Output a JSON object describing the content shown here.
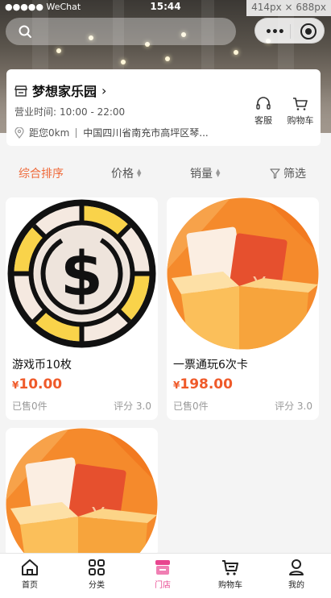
{
  "status_bar": {
    "carrier": "●●●●● WeChat",
    "time": "15:44",
    "dims": "414px × 688px"
  },
  "capsule": {
    "more_glyph": "•••"
  },
  "store": {
    "name": "梦想家乐园",
    "hours_label": "营业时间:",
    "hours_value": "10:00 - 22:00",
    "distance": "距您0km",
    "address": "中国四川省南充市高坪区琴...",
    "service_label": "客服",
    "cart_label": "购物车"
  },
  "sort": {
    "items": [
      {
        "label": "综合排序",
        "active": true
      },
      {
        "label": "价格",
        "active": false
      },
      {
        "label": "销量",
        "active": false
      },
      {
        "label": "筛选",
        "active": false
      }
    ]
  },
  "products": [
    {
      "name": "游戏币10枚",
      "currency": "¥",
      "price": "10.00",
      "sold": "已售0件",
      "rating": "评分 3.0",
      "image": "coin-icon"
    },
    {
      "name": "一票通玩6次卡",
      "currency": "¥",
      "price": "198.00",
      "sold": "已售0件",
      "rating": "评分 3.0",
      "image": "red-envelope-box"
    },
    {
      "name": "",
      "currency": "",
      "price": "",
      "sold": "",
      "rating": "",
      "image": "red-envelope-box"
    }
  ],
  "tabbar": {
    "items": [
      {
        "label": "首页",
        "icon": "home-icon"
      },
      {
        "label": "分类",
        "icon": "grid-icon"
      },
      {
        "label": "门店",
        "icon": "store-icon"
      },
      {
        "label": "购物车",
        "icon": "cart-icon"
      },
      {
        "label": "我的",
        "icon": "user-icon"
      }
    ],
    "active_index": 2
  },
  "colors": {
    "accent": "#ef6a3a",
    "price": "#ef5a2a",
    "tab_active": "#e8458f"
  }
}
